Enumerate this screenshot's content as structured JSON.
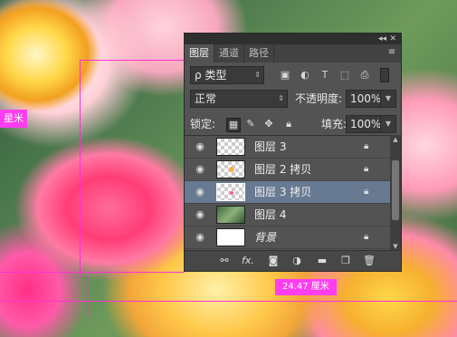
{
  "panel": {
    "tabs": [
      {
        "label": "图层",
        "active": true
      },
      {
        "label": "通道",
        "active": false
      },
      {
        "label": "路径",
        "active": false
      }
    ],
    "filter": {
      "label": "ρ 类型"
    },
    "blend_mode": "正常",
    "opacity_label": "不透明度:",
    "opacity_value": "100%",
    "lock_label": "锁定:",
    "fill_label": "填充:",
    "fill_value": "100%",
    "layers": [
      {
        "name": "图层 3",
        "selected": false
      },
      {
        "name": "图层 2 拷贝",
        "selected": false
      },
      {
        "name": "图层 3 拷贝",
        "selected": true
      },
      {
        "name": "图层 4",
        "selected": false
      },
      {
        "name": "背景",
        "selected": false
      }
    ],
    "footer_fx": "fx."
  },
  "canvas": {
    "measure_left": "星米",
    "measure_bottom": "24.47 厘米"
  },
  "colors": {
    "guide": "#ff2fd6",
    "label_bg": "#ff3df0",
    "selected_layer": "#687a91"
  }
}
